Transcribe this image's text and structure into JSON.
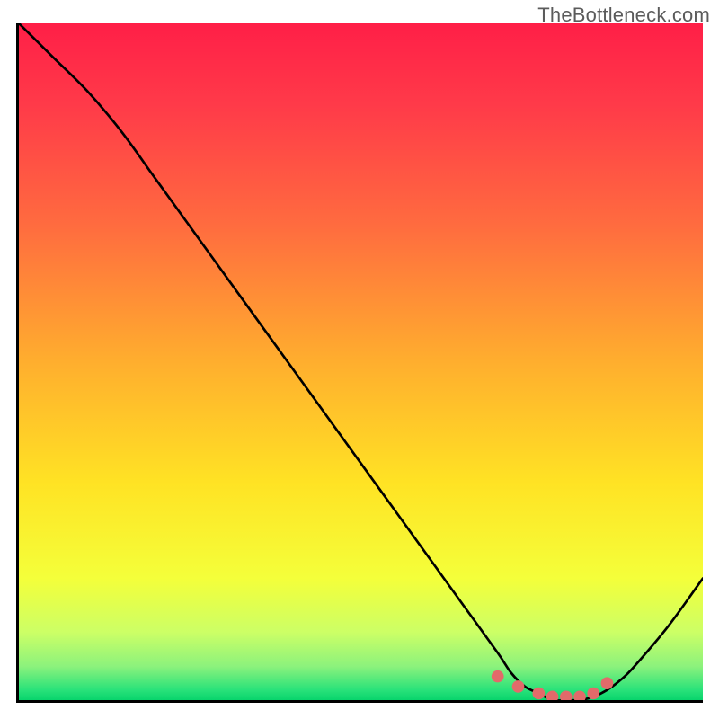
{
  "watermark": "TheBottleneck.com",
  "chart_data": {
    "type": "line",
    "title": "",
    "xlabel": "",
    "ylabel": "",
    "xlim": [
      0,
      100
    ],
    "ylim": [
      0,
      100
    ],
    "grid": false,
    "series": [
      {
        "name": "bottleneck-curve",
        "x": [
          0,
          5,
          10,
          15,
          20,
          25,
          30,
          35,
          40,
          45,
          50,
          55,
          60,
          65,
          70,
          72,
          74,
          76,
          78,
          80,
          82,
          84,
          86,
          88,
          90,
          95,
          100
        ],
        "values": [
          100,
          95,
          90,
          84,
          77,
          70,
          63,
          56,
          49,
          42,
          35,
          28,
          21,
          14,
          7,
          4,
          2,
          1,
          0,
          0,
          0,
          0.5,
          1.5,
          3,
          5,
          11,
          18
        ]
      }
    ],
    "highlight": {
      "name": "bottom-markers",
      "x": [
        70,
        73,
        76,
        78,
        80,
        82,
        84,
        86
      ],
      "values": [
        3.5,
        2.0,
        1.0,
        0.5,
        0.5,
        0.5,
        1.0,
        2.5
      ]
    },
    "background_gradient": {
      "stops": [
        {
          "offset": 0.0,
          "color": "#ff1f47"
        },
        {
          "offset": 0.12,
          "color": "#ff3a49"
        },
        {
          "offset": 0.3,
          "color": "#ff6c3f"
        },
        {
          "offset": 0.5,
          "color": "#ffae2e"
        },
        {
          "offset": 0.68,
          "color": "#ffe324"
        },
        {
          "offset": 0.82,
          "color": "#f4ff3a"
        },
        {
          "offset": 0.9,
          "color": "#ccff66"
        },
        {
          "offset": 0.95,
          "color": "#8cf27c"
        },
        {
          "offset": 0.985,
          "color": "#29e27a"
        },
        {
          "offset": 1.0,
          "color": "#08d46c"
        }
      ]
    }
  }
}
